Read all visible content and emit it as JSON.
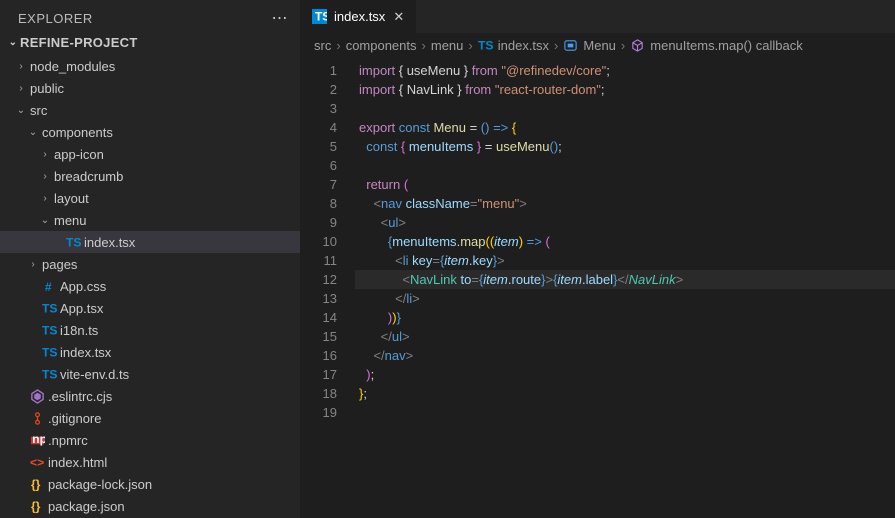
{
  "explorer": {
    "title": "EXPLORER",
    "project": "REFINE-PROJECT"
  },
  "tree": [
    {
      "d": 0,
      "k": "folder",
      "open": false,
      "name": "node_modules"
    },
    {
      "d": 0,
      "k": "folder",
      "open": false,
      "name": "public"
    },
    {
      "d": 0,
      "k": "folder",
      "open": true,
      "name": "src"
    },
    {
      "d": 1,
      "k": "folder",
      "open": true,
      "name": "components"
    },
    {
      "d": 2,
      "k": "folder",
      "open": false,
      "name": "app-icon"
    },
    {
      "d": 2,
      "k": "folder",
      "open": false,
      "name": "breadcrumb"
    },
    {
      "d": 2,
      "k": "folder",
      "open": false,
      "name": "layout"
    },
    {
      "d": 2,
      "k": "folder",
      "open": true,
      "name": "menu"
    },
    {
      "d": 3,
      "k": "file",
      "icon": "ts",
      "name": "index.tsx",
      "sel": true
    },
    {
      "d": 1,
      "k": "folder",
      "open": false,
      "name": "pages"
    },
    {
      "d": 1,
      "k": "file",
      "icon": "hash",
      "name": "App.css"
    },
    {
      "d": 1,
      "k": "file",
      "icon": "ts",
      "name": "App.tsx"
    },
    {
      "d": 1,
      "k": "file",
      "icon": "ts",
      "name": "i18n.ts"
    },
    {
      "d": 1,
      "k": "file",
      "icon": "ts",
      "name": "index.tsx"
    },
    {
      "d": 1,
      "k": "file",
      "icon": "ts",
      "name": "vite-env.d.ts"
    },
    {
      "d": 0,
      "k": "file",
      "icon": "eslint",
      "name": ".eslintrc.cjs"
    },
    {
      "d": 0,
      "k": "file",
      "icon": "git",
      "name": ".gitignore"
    },
    {
      "d": 0,
      "k": "file",
      "icon": "npm",
      "name": ".npmrc"
    },
    {
      "d": 0,
      "k": "file",
      "icon": "html",
      "name": "index.html"
    },
    {
      "d": 0,
      "k": "file",
      "icon": "json",
      "name": "package-lock.json"
    },
    {
      "d": 0,
      "k": "file",
      "icon": "json",
      "name": "package.json"
    }
  ],
  "tab": {
    "icon": "ts",
    "label": "index.tsx"
  },
  "breadcrumbs": [
    {
      "t": "src"
    },
    {
      "t": "components"
    },
    {
      "t": "menu"
    },
    {
      "t": "index.tsx",
      "icon": "ts"
    },
    {
      "t": "Menu",
      "icon": "sym"
    },
    {
      "t": "menuItems.map() callback",
      "icon": "cube"
    }
  ],
  "code": {
    "lines": 19,
    "hl": 12,
    "tokens": [
      [
        [
          "import ",
          "c-pink"
        ],
        [
          "{ ",
          ""
        ],
        [
          "useMenu",
          ""
        ],
        [
          " } ",
          ""
        ],
        [
          "from ",
          "c-pink"
        ],
        [
          "\"@refinedev/core\"",
          "c-str"
        ],
        [
          ";",
          ""
        ]
      ],
      [
        [
          "import ",
          "c-pink"
        ],
        [
          "{ ",
          ""
        ],
        [
          "NavLink",
          ""
        ],
        [
          " } ",
          ""
        ],
        [
          "from ",
          "c-pink"
        ],
        [
          "\"react-router-dom\"",
          "c-str"
        ],
        [
          ";",
          ""
        ]
      ],
      [],
      [
        [
          "export ",
          "c-pink"
        ],
        [
          "const ",
          "c-blue"
        ],
        [
          "Menu ",
          "c-yel"
        ],
        [
          "= ",
          ""
        ],
        [
          "() ",
          "c-cbr"
        ],
        [
          "=> ",
          "c-blue"
        ],
        [
          "{",
          "c-gold"
        ]
      ],
      [
        [
          "  ",
          ""
        ],
        [
          "const ",
          "c-blue"
        ],
        [
          "{ ",
          "c-obr"
        ],
        [
          "menuItems",
          "c-lblue"
        ],
        [
          " } ",
          "c-obr"
        ],
        [
          "= ",
          ""
        ],
        [
          "useMenu",
          "c-yel"
        ],
        [
          "()",
          "c-cbr"
        ],
        [
          ";",
          ""
        ]
      ],
      [],
      [
        [
          "  ",
          ""
        ],
        [
          "return ",
          "c-pink"
        ],
        [
          "(",
          "c-obr"
        ]
      ],
      [
        [
          "    ",
          ""
        ],
        [
          "<",
          "c-grey"
        ],
        [
          "nav ",
          "c-blue"
        ],
        [
          "className",
          "c-lblue"
        ],
        [
          "=",
          "c-grey"
        ],
        [
          "\"menu\"",
          "c-str"
        ],
        [
          ">",
          "c-grey"
        ]
      ],
      [
        [
          "      ",
          ""
        ],
        [
          "<",
          "c-grey"
        ],
        [
          "ul",
          "c-blue"
        ],
        [
          ">",
          "c-grey"
        ]
      ],
      [
        [
          "        ",
          ""
        ],
        [
          "{",
          "c-cbr"
        ],
        [
          "menuItems",
          "c-lblue"
        ],
        [
          ".",
          ""
        ],
        [
          "map",
          "c-yel"
        ],
        [
          "((",
          "c-gold"
        ],
        [
          "item",
          "c-lblue c-it"
        ],
        [
          ") ",
          "c-gold"
        ],
        [
          "=> ",
          "c-blue"
        ],
        [
          "(",
          "c-obr"
        ]
      ],
      [
        [
          "          ",
          ""
        ],
        [
          "<",
          "c-grey"
        ],
        [
          "li ",
          "c-blue"
        ],
        [
          "key",
          "c-lblue"
        ],
        [
          "=",
          "c-grey"
        ],
        [
          "{",
          "c-cbr"
        ],
        [
          "item",
          "c-lblue c-it"
        ],
        [
          ".",
          ""
        ],
        [
          "key",
          "c-lblue"
        ],
        [
          "}",
          "c-cbr"
        ],
        [
          ">",
          "c-grey"
        ]
      ],
      [
        [
          "            ",
          ""
        ],
        [
          "<",
          "c-grey"
        ],
        [
          "NavLink ",
          "c-type"
        ],
        [
          "to",
          "c-lblue"
        ],
        [
          "=",
          "c-grey"
        ],
        [
          "{",
          "c-cbr"
        ],
        [
          "item",
          "c-lblue c-it"
        ],
        [
          ".",
          ""
        ],
        [
          "route",
          "c-lblue"
        ],
        [
          "}",
          "c-cbr"
        ],
        [
          ">",
          "c-grey"
        ],
        [
          "{",
          "c-cbr"
        ],
        [
          "item",
          "c-lblue c-it"
        ],
        [
          ".",
          ""
        ],
        [
          "label",
          "c-lblue"
        ],
        [
          "}",
          "c-cbr"
        ],
        [
          "</",
          "c-grey"
        ],
        [
          "NavLink",
          "c-type c-it"
        ],
        [
          ">",
          "c-grey"
        ]
      ],
      [
        [
          "          ",
          ""
        ],
        [
          "</",
          "c-grey"
        ],
        [
          "li",
          "c-blue"
        ],
        [
          ">",
          "c-grey"
        ]
      ],
      [
        [
          "        ",
          ""
        ],
        [
          ")",
          "c-obr"
        ],
        [
          ")",
          "c-gold"
        ],
        [
          "}",
          "c-cbr"
        ]
      ],
      [
        [
          "      ",
          ""
        ],
        [
          "</",
          "c-grey"
        ],
        [
          "ul",
          "c-blue"
        ],
        [
          ">",
          "c-grey"
        ]
      ],
      [
        [
          "    ",
          ""
        ],
        [
          "</",
          "c-grey"
        ],
        [
          "nav",
          "c-blue"
        ],
        [
          ">",
          "c-grey"
        ]
      ],
      [
        [
          "  ",
          ""
        ],
        [
          ")",
          "c-obr"
        ],
        [
          ";",
          ""
        ]
      ],
      [
        [
          "}",
          "c-gold"
        ],
        [
          ";",
          ""
        ]
      ],
      []
    ]
  }
}
